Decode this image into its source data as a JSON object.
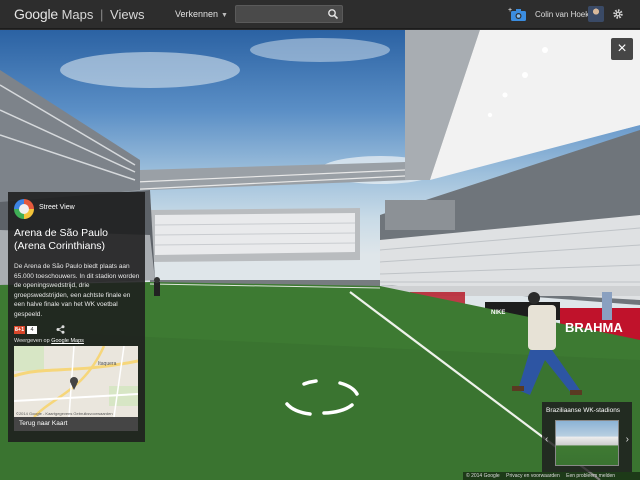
{
  "topbar": {
    "brand_google": "Google",
    "brand_maps": "Maps",
    "brand_sep": "|",
    "brand_views": "Views",
    "explore_label": "Verkennen",
    "search_value": "",
    "user_name": "Colin van Hoek",
    "icons": {
      "camera": "camera-plus-icon",
      "search": "search-icon",
      "settings": "gear-icon"
    }
  },
  "close_label": "×",
  "panel": {
    "street_view_label": "Street View",
    "title": "Arena de São Paulo (Arena Corinthians)",
    "description": "De Arena de São Paulo biedt plaats aan 65.000 toeschouwers. In dit stadion worden de openingswedstrijd, drie groepswedstrijden, een achtste finale en een halve finale van het WK voetbal gespeeld.",
    "gplus_label": "8+1",
    "gplus_count": "4",
    "view_on_prefix": "Weergeven op ",
    "view_on_link": "Google Maps",
    "map_place_label": "Itaquera",
    "map_credit": "©2014 Google - Kaartgegevens   Gebruiksvoorwaarden",
    "back_label": "Terug naar Kaart"
  },
  "scene_ads": {
    "brahma": "BRAHMA",
    "nike": "NIKE"
  },
  "carousel": {
    "title": "Braziliaanse WK-stadions",
    "prev": "‹",
    "next": "›"
  },
  "footer": {
    "copyright": "© 2014 Google",
    "privacy": "Privacy en voorwaarden",
    "report": "Een probleem melden"
  },
  "colors": {
    "topbar_bg": "#2d2d2d",
    "panel_bg": "#1e1e1e",
    "grass": "#3d7a32",
    "brahma_red": "#c0122b",
    "gplus_red": "#d9472b"
  }
}
